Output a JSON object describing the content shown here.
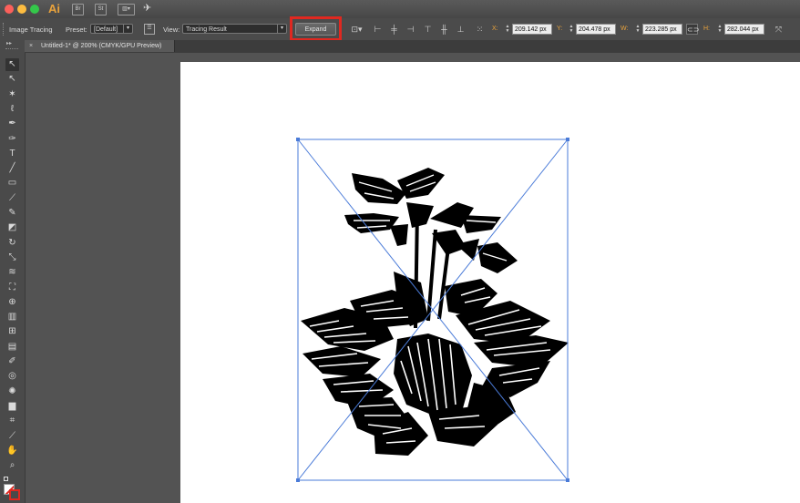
{
  "app": {
    "logo": "Ai",
    "bridge_icon_label": "Br",
    "stock_icon_label": "St"
  },
  "titlebar": {
    "window_controls": [
      "close",
      "minimize",
      "zoom"
    ],
    "colors": {
      "close": "#fc605b",
      "minimize": "#fdbc40",
      "zoom": "#34c84a"
    }
  },
  "control_bar": {
    "panel_label": "Image Tracing",
    "preset_label": "Preset:",
    "preset_value": "[Default]",
    "view_label": "View:",
    "view_value": "Tracing Result",
    "expand_button": "Expand",
    "x_label": "X:",
    "x_value": "209.142 px",
    "y_label": "Y:",
    "y_value": "204.478 px",
    "w_label": "W:",
    "w_value": "223.285 px",
    "h_label": "H:",
    "h_value": "282.044 px"
  },
  "document": {
    "tab_title": "Untitled-1* @ 200% (CMYK/GPU Preview)",
    "close_glyph": "×"
  },
  "tools": [
    {
      "name": "selection-tool",
      "glyph": "↖"
    },
    {
      "name": "direct-selection-tool",
      "glyph": "↖"
    },
    {
      "name": "magic-wand-tool",
      "glyph": "✶"
    },
    {
      "name": "lasso-tool",
      "glyph": "ℓ"
    },
    {
      "name": "pen-tool",
      "glyph": "✒"
    },
    {
      "name": "curvature-tool",
      "glyph": "✑"
    },
    {
      "name": "type-tool",
      "glyph": "T"
    },
    {
      "name": "line-tool",
      "glyph": "╱"
    },
    {
      "name": "rectangle-tool",
      "glyph": "▭"
    },
    {
      "name": "paintbrush-tool",
      "glyph": "⟋"
    },
    {
      "name": "shaper-tool",
      "glyph": "✎"
    },
    {
      "name": "eraser-tool",
      "glyph": "◩"
    },
    {
      "name": "rotate-tool",
      "glyph": "↻"
    },
    {
      "name": "scale-tool",
      "glyph": "⤡"
    },
    {
      "name": "warp-tool",
      "glyph": "≋"
    },
    {
      "name": "free-transform-tool",
      "glyph": "⛶"
    },
    {
      "name": "shape-builder-tool",
      "glyph": "⊕"
    },
    {
      "name": "graph-tool",
      "glyph": "▥"
    },
    {
      "name": "mesh-tool",
      "glyph": "⊞"
    },
    {
      "name": "gradient-tool",
      "glyph": "▤"
    },
    {
      "name": "eyedropper-tool",
      "glyph": "✐"
    },
    {
      "name": "blend-tool",
      "glyph": "◎"
    },
    {
      "name": "symbol-sprayer-tool",
      "glyph": "✺"
    },
    {
      "name": "column-graph-tool",
      "glyph": "▆"
    },
    {
      "name": "artboard-tool",
      "glyph": "⌗"
    },
    {
      "name": "slice-tool",
      "glyph": "⟋"
    },
    {
      "name": "hand-tool",
      "glyph": "✋"
    },
    {
      "name": "zoom-tool",
      "glyph": "⌕"
    }
  ]
}
